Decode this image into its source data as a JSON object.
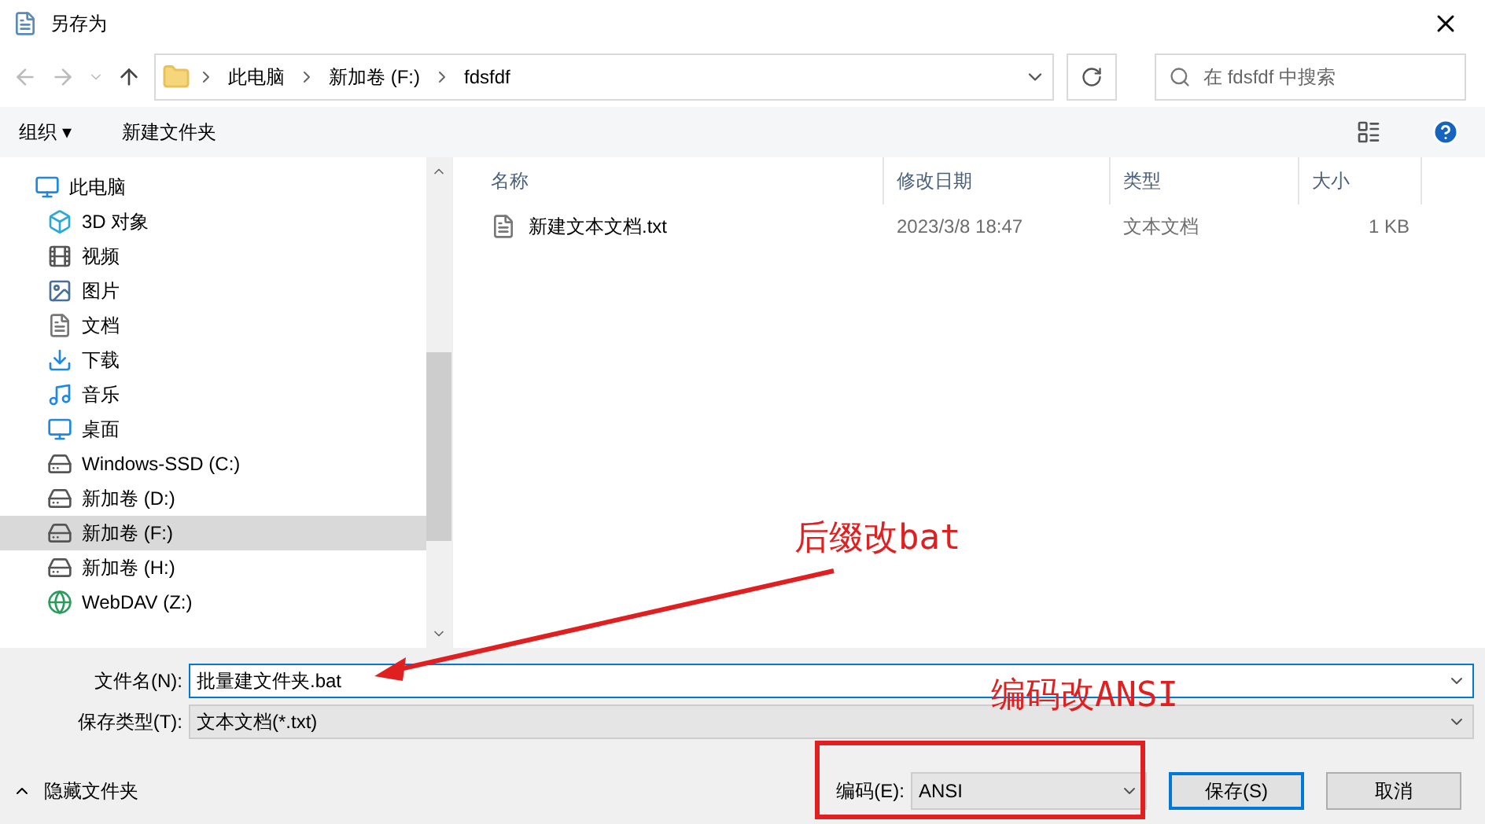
{
  "window": {
    "title": "另存为"
  },
  "address": {
    "crumbs": [
      "此电脑",
      "新加卷 (F:)",
      "fdsfdf"
    ],
    "search_placeholder": "在 fdsfdf 中搜索"
  },
  "toolbar": {
    "organize": "组织 ▾",
    "new_folder": "新建文件夹"
  },
  "sidebar": {
    "items": [
      {
        "label": "此电脑",
        "selected": false,
        "children": [
          {
            "label": "3D 对象",
            "selected": false
          },
          {
            "label": "视频",
            "selected": false
          },
          {
            "label": "图片",
            "selected": false
          },
          {
            "label": "文档",
            "selected": false
          },
          {
            "label": "下载",
            "selected": false
          },
          {
            "label": "音乐",
            "selected": false
          },
          {
            "label": "桌面",
            "selected": false
          },
          {
            "label": "Windows-SSD (C:)",
            "selected": false
          },
          {
            "label": "新加卷 (D:)",
            "selected": false
          },
          {
            "label": "新加卷 (F:)",
            "selected": true
          },
          {
            "label": "新加卷 (H:)",
            "selected": false
          },
          {
            "label": "WebDAV (Z:)",
            "selected": false
          }
        ]
      }
    ]
  },
  "table": {
    "columns": [
      "名称",
      "修改日期",
      "类型",
      "大小"
    ],
    "rows": [
      {
        "name": "新建文本文档.txt",
        "date": "2023/3/8 18:47",
        "type": "文本文档",
        "size": "1 KB"
      }
    ]
  },
  "form": {
    "filename_label": "文件名(N):",
    "filename": "批量建文件夹.bat",
    "type_label": "保存类型(T):",
    "type": "文本文档(*.txt)",
    "encoding_label": "编码(E):",
    "encoding": "ANSI",
    "hide_folders": "隐藏文件夹",
    "save": "保存(S)",
    "cancel": "取消"
  },
  "annotations": [
    {
      "kind": "arrow-note",
      "text": "后缀改bat"
    },
    {
      "kind": "box-note",
      "text": "编码改ANSI"
    }
  ]
}
